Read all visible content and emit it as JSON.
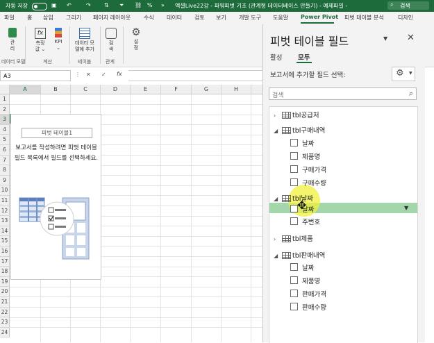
{
  "titlebar": {
    "autosave": "자동 저장",
    "filename": "엑셀Live22강 - 파워피벗 기초 (관계형 데이터베이스 만들기) - 예제파일 -",
    "search": "검색"
  },
  "tabs": [
    "파일",
    "홈",
    "삽입",
    "그리기",
    "페이지 레이아웃",
    "수식",
    "데이터",
    "검토",
    "보기",
    "개발 도구",
    "도움말",
    "Power Pivot",
    "피벗 테이블 분석",
    "디자인"
  ],
  "ribbon": {
    "buttons": [
      "관\n리",
      "측정\n값 ⌄",
      "KPI\n⌄",
      "데이터 모\n델에 추가",
      "검\n색",
      "설\n정"
    ],
    "groups": [
      "데이터 모델",
      "계산",
      "테이블",
      "관계"
    ]
  },
  "namebox": "A3",
  "formula_icons": [
    "✕",
    "✓",
    "fx"
  ],
  "grid": {
    "columns": [
      "A",
      "B",
      "C",
      "D",
      "E",
      "F",
      "G",
      "H"
    ],
    "rows": [
      "1",
      "2",
      "3",
      "4",
      "5",
      "6",
      "7",
      "8",
      "9",
      "10",
      "11",
      "12",
      "13",
      "14",
      "15",
      "16",
      "17",
      "18",
      "19",
      "20",
      "21",
      "22",
      "23",
      "24"
    ]
  },
  "pivot_placeholder": {
    "name": "피벗 테이블1",
    "message": "보고서를 작성하려면 피벗 테이블 필드 목록에서 필드를 선택하세요."
  },
  "pane": {
    "title": "피벗 테이블 필드",
    "tabs": [
      "활성",
      "모두"
    ],
    "prompt": "보고서에 추가할 필드 선택:",
    "search_placeholder": "검색",
    "tables": [
      {
        "name": "tbl공급처",
        "expanded": false,
        "fields": []
      },
      {
        "name": "tbl구매내역",
        "expanded": true,
        "fields": [
          "날짜",
          "제품명",
          "구매가격",
          "구매수량"
        ]
      },
      {
        "name": "tbl날짜",
        "expanded": true,
        "fields": [
          "날짜",
          "주번호"
        ]
      },
      {
        "name": "tbl제품",
        "expanded": false,
        "fields": []
      },
      {
        "name": "tbl판매내역",
        "expanded": true,
        "fields": [
          "날짜",
          "제품명",
          "판매가격",
          "판매수량"
        ]
      }
    ]
  },
  "colors": {
    "excel_green": "#1d6b3b",
    "drag_highlight": "#a3d6ab",
    "cursor_highlight": "#f0f03c"
  }
}
